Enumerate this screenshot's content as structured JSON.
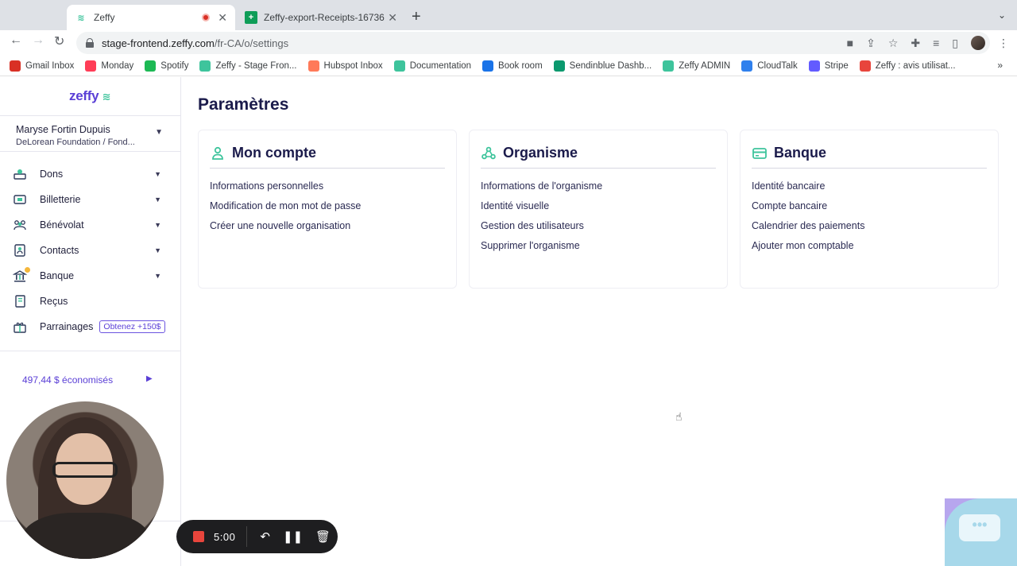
{
  "browser": {
    "tabs": [
      {
        "title": "Zeffy",
        "active": true
      },
      {
        "title": "Zeffy-export-Receipts-16736",
        "active": false
      }
    ],
    "url_host": "stage-frontend.zeffy.com",
    "url_path": "/fr-CA/o/settings",
    "bookmarks": [
      {
        "label": "Gmail Inbox",
        "icon": "gmail-icon",
        "color": "#d93025"
      },
      {
        "label": "Monday",
        "icon": "monday-icon",
        "color": "#ff3d57"
      },
      {
        "label": "Spotify",
        "icon": "spotify-icon",
        "color": "#1db954"
      },
      {
        "label": "Zeffy - Stage Fron...",
        "icon": "zeffy-icon",
        "color": "#3ec49c"
      },
      {
        "label": "Hubspot Inbox",
        "icon": "hubspot-icon",
        "color": "#ff7a59"
      },
      {
        "label": "Documentation",
        "icon": "zeffy-icon",
        "color": "#3ec49c"
      },
      {
        "label": "Book room",
        "icon": "calendar-icon",
        "color": "#1a73e8"
      },
      {
        "label": "Sendinblue Dashb...",
        "icon": "sendinblue-icon",
        "color": "#0b996e"
      },
      {
        "label": "Zeffy ADMIN",
        "icon": "zeffy-icon",
        "color": "#3ec49c"
      },
      {
        "label": "CloudTalk",
        "icon": "cloudtalk-icon",
        "color": "#2f80ed"
      },
      {
        "label": "Stripe",
        "icon": "stripe-icon",
        "color": "#635bff"
      },
      {
        "label": "Zeffy : avis utilisat...",
        "icon": "send-icon",
        "color": "#e8453c"
      }
    ],
    "bookmarks_more": "»"
  },
  "sidebar": {
    "logo": "zeffy",
    "account_name": "Maryse Fortin Dupuis",
    "account_org": "DeLorean Foundation / Fond...",
    "items": [
      {
        "label": "Dons",
        "icon": "donation-icon",
        "has_chevron": true
      },
      {
        "label": "Billetterie",
        "icon": "ticket-icon",
        "has_chevron": true
      },
      {
        "label": "Bénévolat",
        "icon": "volunteers-icon",
        "has_chevron": true
      },
      {
        "label": "Contacts",
        "icon": "contacts-icon",
        "has_chevron": true
      },
      {
        "label": "Banque",
        "icon": "bank-icon",
        "has_chevron": true,
        "notification": true
      },
      {
        "label": "Reçus",
        "icon": "receipt-icon",
        "has_chevron": false
      },
      {
        "label": "Parrainages",
        "icon": "gift-icon",
        "has_chevron": false,
        "badge": "Obtenez +150$"
      }
    ],
    "savings": "497,44 $ économisés"
  },
  "main": {
    "title": "Paramètres",
    "cards": [
      {
        "title": "Mon compte",
        "icon": "user-icon",
        "links": [
          "Informations personnelles",
          "Modification de mon mot de passe",
          "Créer une nouvelle organisation"
        ]
      },
      {
        "title": "Organisme",
        "icon": "organization-icon",
        "links": [
          "Informations de l'organisme",
          "Identité visuelle",
          "Gestion des utilisateurs",
          "Supprimer l'organisme"
        ]
      },
      {
        "title": "Banque",
        "icon": "bank-card-icon",
        "links": [
          "Identité bancaire",
          "Compte bancaire",
          "Calendrier des paiements",
          "Ajouter mon comptable"
        ]
      }
    ]
  },
  "recorder": {
    "timer": "5:00"
  },
  "colors": {
    "brand": "#5a3fd6",
    "accent": "#3ec49c",
    "title": "#1b1b4b"
  }
}
